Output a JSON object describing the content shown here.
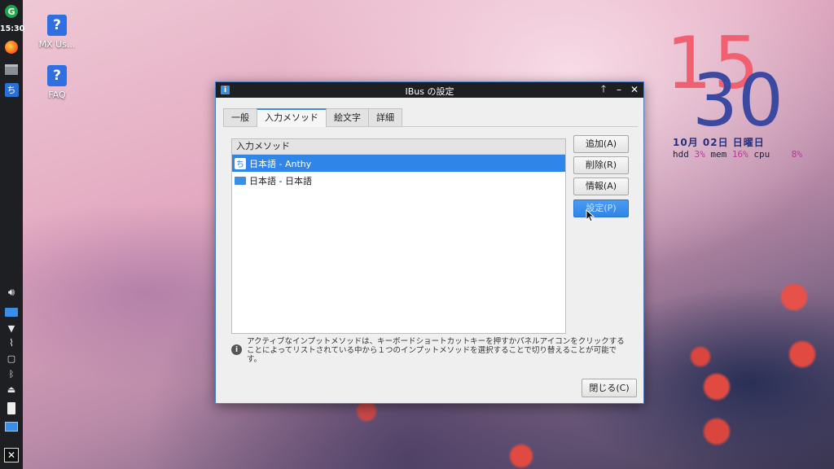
{
  "panel": {
    "clock": "15:30"
  },
  "desktop_icons": [
    {
      "label": "MX Us...",
      "icon": "help-icon"
    },
    {
      "label": "FAQ",
      "icon": "help-icon"
    }
  ],
  "conky": {
    "hour": "15",
    "minute": "30",
    "date": "10月 02日 日曜日",
    "hdd_label": "hdd",
    "hdd_value": "3%",
    "mem_label": "mem",
    "mem_value": "16%",
    "cpu_label": "cpu",
    "cpu_value": "8%"
  },
  "dialog": {
    "title": "IBus の設定",
    "title_icon": "i",
    "tabs": [
      "一般",
      "入力メソッド",
      "絵文字",
      "詳細"
    ],
    "active_tab": 1,
    "list_header": "入力メソッド",
    "methods": [
      {
        "label": "日本語 - Anthy",
        "icon": "ち",
        "selected": true
      },
      {
        "label": "日本語 - 日本語",
        "icon": "keyboard",
        "selected": false
      }
    ],
    "buttons": {
      "add": "追加(A)",
      "remove": "削除(R)",
      "info": "情報(A)",
      "settings": "設定(P)"
    },
    "info_text": "アクティブなインプットメソッドは、キーボードショートカットキーを押すかパネルアイコンをクリックすることによってリストされている中から１つのインプットメソッドを選択することで切り替えることが可能です。",
    "close": "閉じる(C)"
  },
  "colors": {
    "accent": "#2f86e8",
    "conky_hour": "#f06070",
    "conky_minute": "#3b4aa0"
  }
}
